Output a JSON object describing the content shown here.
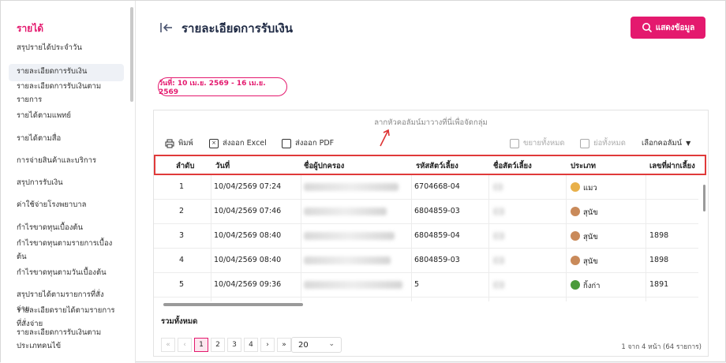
{
  "sidebar": {
    "title": "รายได้",
    "items": [
      {
        "label": "สรุปรายได้ประจำวัน",
        "active": false
      },
      {
        "label": "รายละเอียดการรับเงิน",
        "active": true
      },
      {
        "label": "รายละเอียดการรับเงินตาม",
        "active": false
      },
      {
        "label": "รายการ",
        "active": false
      },
      {
        "label": "รายได้ตามแพทย์",
        "active": false
      },
      {
        "label": "รายได้ตามสื่อ",
        "active": false
      },
      {
        "label": "การจ่ายสินค้าและบริการ",
        "active": false
      },
      {
        "label": "สรุปการรับเงิน",
        "active": false
      },
      {
        "label": "ค่าใช้จ่ายโรงพยาบาล",
        "active": false
      },
      {
        "label": "กำไรขาดทุนเบื้องต้น",
        "active": false
      },
      {
        "label": "กำไรขาดทุนตามรายการเบื้อง",
        "active": false
      },
      {
        "label": "ต้น",
        "active": false
      },
      {
        "label": "กำไรขาดทุนตามวันเบื้องต้น",
        "active": false
      },
      {
        "label": "สรุปรายได้ตามรายการที่สั่งจ่าย",
        "active": false
      },
      {
        "label": "รายละเอียดรายได้ตามรายการ",
        "active": false
      },
      {
        "label": "ที่สั่งจ่าย",
        "active": false
      },
      {
        "label": "รายละเอียดการรับเงินตาม",
        "active": false
      },
      {
        "label": "ประเภทคนไข้",
        "active": false
      }
    ]
  },
  "header": {
    "title": "รายละเอียดการรับเงิน",
    "show_button": "แสดงข้อมูล"
  },
  "date_filter": "วันที่: 10 เม.ย. 2569 - 16 เม.ย. 2569",
  "grid": {
    "group_hint": "ลากหัวคอลัมน์มาวางที่นี่เพื่อจัดกลุ่ม",
    "toolbar": {
      "print": "พิมพ์",
      "export_excel": "ส่งออก Excel",
      "export_pdf": "ส่งออก PDF",
      "expand_all": "ขยายทั้งหมด",
      "collapse_all": "ย่อทั้งหมด",
      "choose_columns": "เลือกคอลัมน์"
    },
    "columns": [
      "ลำดับ",
      "วันที่",
      "ชื่อผู้ปกครอง",
      "รหัสสัตว์เลี้ยง",
      "ชื่อสัตว์เลี้ยง",
      "ประเภท",
      "เลขที่ฝากเลี้ยง"
    ],
    "rows": [
      {
        "no": "1",
        "date": "10/04/2569 07:24",
        "pet_code": "6704668-04",
        "type": "แมว",
        "type_color": "#e8b04a",
        "deposit": ""
      },
      {
        "no": "2",
        "date": "10/04/2569 07:46",
        "pet_code": "6804859-03",
        "type": "สุนัข",
        "type_color": "#c98a5a",
        "deposit": ""
      },
      {
        "no": "3",
        "date": "10/04/2569 08:40",
        "pet_code": "6804859-04",
        "type": "สุนัข",
        "type_color": "#c98a5a",
        "deposit": "1898"
      },
      {
        "no": "4",
        "date": "10/04/2569 08:40",
        "pet_code": "6804859-03",
        "type": "สุนัข",
        "type_color": "#c98a5a",
        "deposit": "1898"
      },
      {
        "no": "5",
        "date": "10/04/2569 09:36",
        "pet_code": "5",
        "type": "กิ้งก่า",
        "type_color": "#4a9a3a",
        "deposit": "1891"
      }
    ],
    "total_label": "รวมทั้งหมด",
    "pager": {
      "first": "«",
      "prev": "‹",
      "next": "›",
      "last": "»",
      "pages": [
        "1",
        "2",
        "3",
        "4"
      ],
      "current": "1",
      "page_size": "20",
      "info": "1 จาก 4 หน้า (64 รายการ)"
    }
  },
  "colors": {
    "accent": "#e4196e",
    "highlight_border": "#e03a3a"
  }
}
